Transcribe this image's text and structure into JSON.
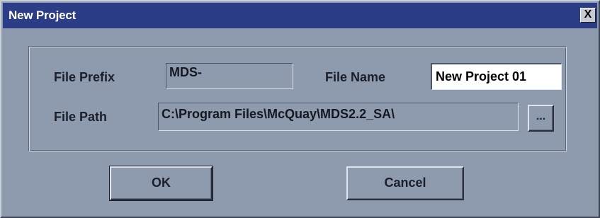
{
  "window": {
    "title": "New Project",
    "close_label": "X"
  },
  "form": {
    "file_prefix_label": "File Prefix",
    "file_prefix_value": "MDS-",
    "file_name_label": "File Name",
    "file_name_value": "New Project 01",
    "file_path_label": "File Path",
    "file_path_value": "C:\\Program Files\\McQuay\\MDS2.2_SA\\",
    "browse_label": "..."
  },
  "buttons": {
    "ok_label": "OK",
    "cancel_label": "Cancel"
  }
}
